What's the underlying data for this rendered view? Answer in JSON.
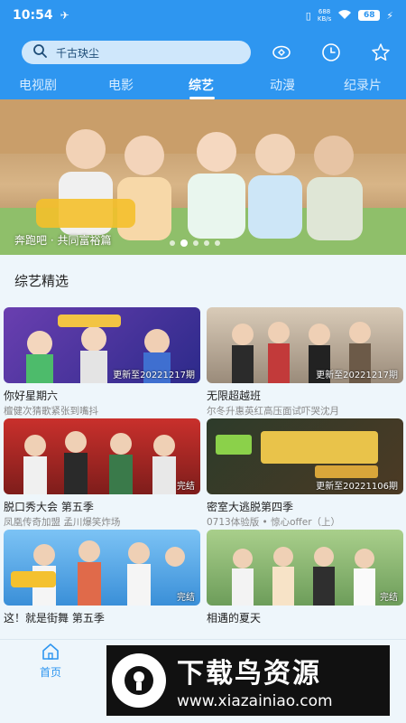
{
  "status_bar": {
    "time": "10:54",
    "speed_value": "688",
    "speed_unit": "KB/s",
    "battery": "68"
  },
  "search": {
    "query": "千古玦尘"
  },
  "tabs": [
    {
      "label": "电视剧",
      "active": false
    },
    {
      "label": "电影",
      "active": false
    },
    {
      "label": "综艺",
      "active": true
    },
    {
      "label": "动漫",
      "active": false
    },
    {
      "label": "纪录片",
      "active": false
    }
  ],
  "banner": {
    "caption": "奔跑吧 · 共同富裕篇",
    "dot_count": 5,
    "active_dot": 1
  },
  "section": {
    "title": "综艺精选"
  },
  "cards": [
    {
      "title": "你好星期六",
      "subtitle": "檀健次猜歌紧张到嘴抖",
      "badge": "更新至20221217期"
    },
    {
      "title": "无限超越班",
      "subtitle": "尔冬升惠英红高压面试吓哭沈月",
      "badge": "更新至20221217期"
    },
    {
      "title": "脱口秀大会 第五季",
      "subtitle": "凤凰传奇加盟 孟川爆笑炸场",
      "badge": "完结"
    },
    {
      "title": "密室大逃脱第四季",
      "subtitle": "0713体验版 • 惊心offer（上）",
      "badge": "更新至20221106期"
    },
    {
      "title": "这！就是街舞 第五季",
      "subtitle": "",
      "badge": "完结"
    },
    {
      "title": "相遇的夏天",
      "subtitle": "",
      "badge": "完结"
    }
  ],
  "bottom_nav": {
    "home_label": "首页"
  },
  "watermark": {
    "title": "下载鸟资源",
    "url": "www.xiazainiao.com"
  }
}
